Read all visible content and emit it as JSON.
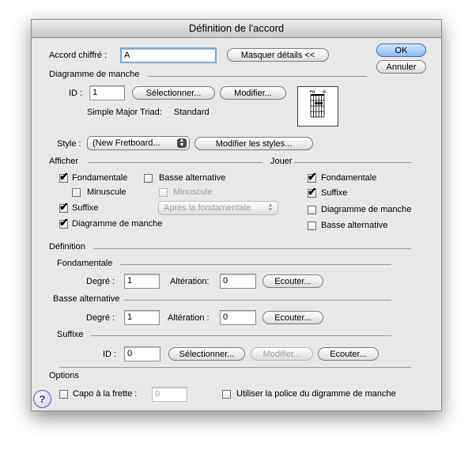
{
  "title": "Définition de l'accord",
  "chord": {
    "label": "Accord chiffré :",
    "value": "A",
    "toggle_btn": "Masquer détails <<"
  },
  "ok": "OK",
  "cancel": "Annuler",
  "diagram": {
    "section": "Diagramme de manche",
    "id_label": "ID :",
    "id_value": "1",
    "select_btn": "Sélectionner...",
    "modify_btn": "Modifier...",
    "name": "Simple Major Triad:",
    "variant": "Standard"
  },
  "style": {
    "label": "Style :",
    "value": "(New Fretboard...",
    "modify_btn": "Modifier les styles..."
  },
  "show": {
    "section": "Afficher",
    "root": "Fondamentale",
    "alt_bass": "Basse alternative",
    "lowercase": "Minuscule",
    "lowercase2": "Minuscule",
    "suffix": "Suffixe",
    "suffix_pos": "Après la fondamentale",
    "fretboard": "Diagramme de manche"
  },
  "play": {
    "section": "Jouer",
    "root": "Fondamentale",
    "suffix": "Suffixe",
    "fretboard": "Diagramme de manche",
    "alt_bass": "Basse alternative"
  },
  "definition": {
    "section": "Définition",
    "root": {
      "section": "Fondamentale",
      "degree_label": "Degré :",
      "degree": "1",
      "alter_label": "Altération:",
      "alter": "0",
      "listen": "Ecouter..."
    },
    "alt_bass": {
      "section": "Basse alternative",
      "degree_label": "Degré :",
      "degree": "1",
      "alter_label": "Altération :",
      "alter": "0",
      "listen": "Ecouter..."
    },
    "suffix": {
      "section": "Suffixe",
      "id_label": "ID :",
      "id": "0",
      "select": "Sélectionner...",
      "modify": "Modifier...",
      "listen": "Ecouter..."
    }
  },
  "options": {
    "section": "Options",
    "capo_label": "Capo à la frette :",
    "capo_value": "0",
    "use_font": "Utiliser la police du digramme de manche"
  },
  "help": "?"
}
